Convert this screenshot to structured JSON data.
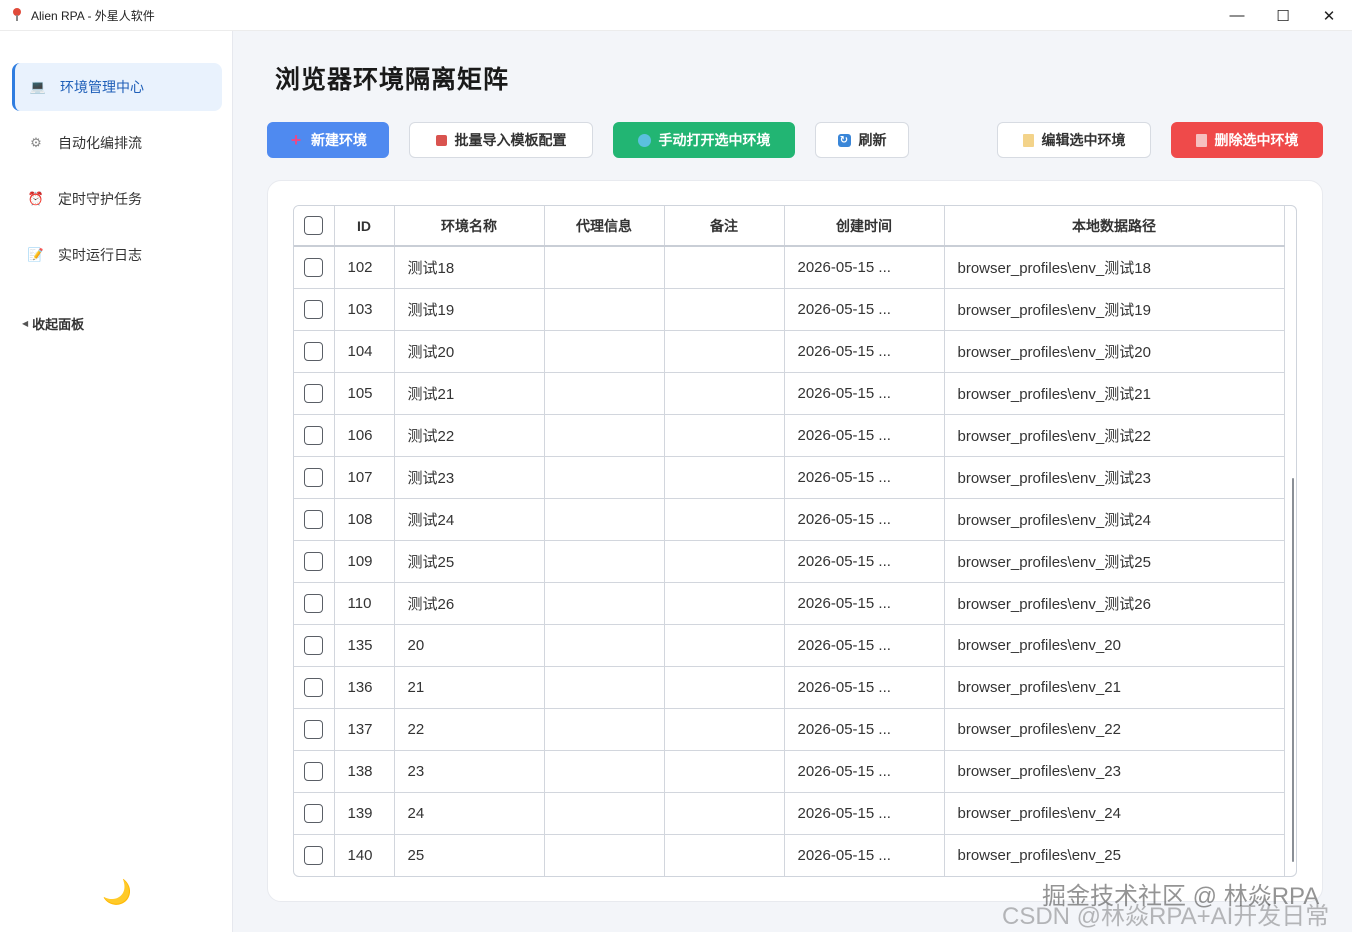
{
  "window": {
    "title": "Alien RPA - 外星人软件",
    "minimize": "—",
    "maximize": "☐",
    "close": "✕"
  },
  "sidebar": {
    "items": [
      {
        "label": "环境管理中心",
        "icon": "laptop-icon",
        "glyph": "💻",
        "active": true
      },
      {
        "label": "自动化编排流",
        "icon": "gear-icon",
        "glyph": "⚙"
      },
      {
        "label": "定时守护任务",
        "icon": "alarm-clock-icon",
        "glyph": "⏰"
      },
      {
        "label": "实时运行日志",
        "icon": "memo-icon",
        "glyph": "📝"
      }
    ],
    "collapse_label": "收起面板",
    "collapse_glyph": "◀",
    "theme_glyph": "🌙"
  },
  "main": {
    "title": "浏览器环境隔离矩阵",
    "toolbar": {
      "new_label": "新建环境",
      "import_label": "批量导入模板配置",
      "open_label": "手动打开选中环境",
      "refresh_label": "刷新",
      "edit_label": "编辑选中环境",
      "delete_label": "删除选中环境"
    },
    "table": {
      "headers": [
        "ID",
        "环境名称",
        "代理信息",
        "备注",
        "创建时间",
        "本地数据路径"
      ],
      "rows": [
        {
          "id": "102",
          "name": "测试18",
          "proxy": "",
          "note": "",
          "created": "2026-05-15 ...",
          "path": "browser_profiles\\env_测试18"
        },
        {
          "id": "103",
          "name": "测试19",
          "proxy": "",
          "note": "",
          "created": "2026-05-15 ...",
          "path": "browser_profiles\\env_测试19"
        },
        {
          "id": "104",
          "name": "测试20",
          "proxy": "",
          "note": "",
          "created": "2026-05-15 ...",
          "path": "browser_profiles\\env_测试20"
        },
        {
          "id": "105",
          "name": "测试21",
          "proxy": "",
          "note": "",
          "created": "2026-05-15 ...",
          "path": "browser_profiles\\env_测试21"
        },
        {
          "id": "106",
          "name": "测试22",
          "proxy": "",
          "note": "",
          "created": "2026-05-15 ...",
          "path": "browser_profiles\\env_测试22"
        },
        {
          "id": "107",
          "name": "测试23",
          "proxy": "",
          "note": "",
          "created": "2026-05-15 ...",
          "path": "browser_profiles\\env_测试23"
        },
        {
          "id": "108",
          "name": "测试24",
          "proxy": "",
          "note": "",
          "created": "2026-05-15 ...",
          "path": "browser_profiles\\env_测试24"
        },
        {
          "id": "109",
          "name": "测试25",
          "proxy": "",
          "note": "",
          "created": "2026-05-15 ...",
          "path": "browser_profiles\\env_测试25"
        },
        {
          "id": "110",
          "name": "测试26",
          "proxy": "",
          "note": "",
          "created": "2026-05-15 ...",
          "path": "browser_profiles\\env_测试26"
        },
        {
          "id": "135",
          "name": "20",
          "proxy": "",
          "note": "",
          "created": "2026-05-15 ...",
          "path": "browser_profiles\\env_20"
        },
        {
          "id": "136",
          "name": "21",
          "proxy": "",
          "note": "",
          "created": "2026-05-15 ...",
          "path": "browser_profiles\\env_21"
        },
        {
          "id": "137",
          "name": "22",
          "proxy": "",
          "note": "",
          "created": "2026-05-15 ...",
          "path": "browser_profiles\\env_22"
        },
        {
          "id": "138",
          "name": "23",
          "proxy": "",
          "note": "",
          "created": "2026-05-15 ...",
          "path": "browser_profiles\\env_23"
        },
        {
          "id": "139",
          "name": "24",
          "proxy": "",
          "note": "",
          "created": "2026-05-15 ...",
          "path": "browser_profiles\\env_24"
        },
        {
          "id": "140",
          "name": "25",
          "proxy": "",
          "note": "",
          "created": "2026-05-15 ...",
          "path": "browser_profiles\\env_25"
        }
      ]
    }
  },
  "watermark": {
    "line1": "掘金技术社区 @ 林焱RPA",
    "line2": "CSDN @林焱RPA+AI开发日常"
  },
  "colors": {
    "primary": "#4f8af0",
    "success": "#22b573",
    "danger": "#ef4a4a",
    "active_bg": "#e9f2fd"
  }
}
